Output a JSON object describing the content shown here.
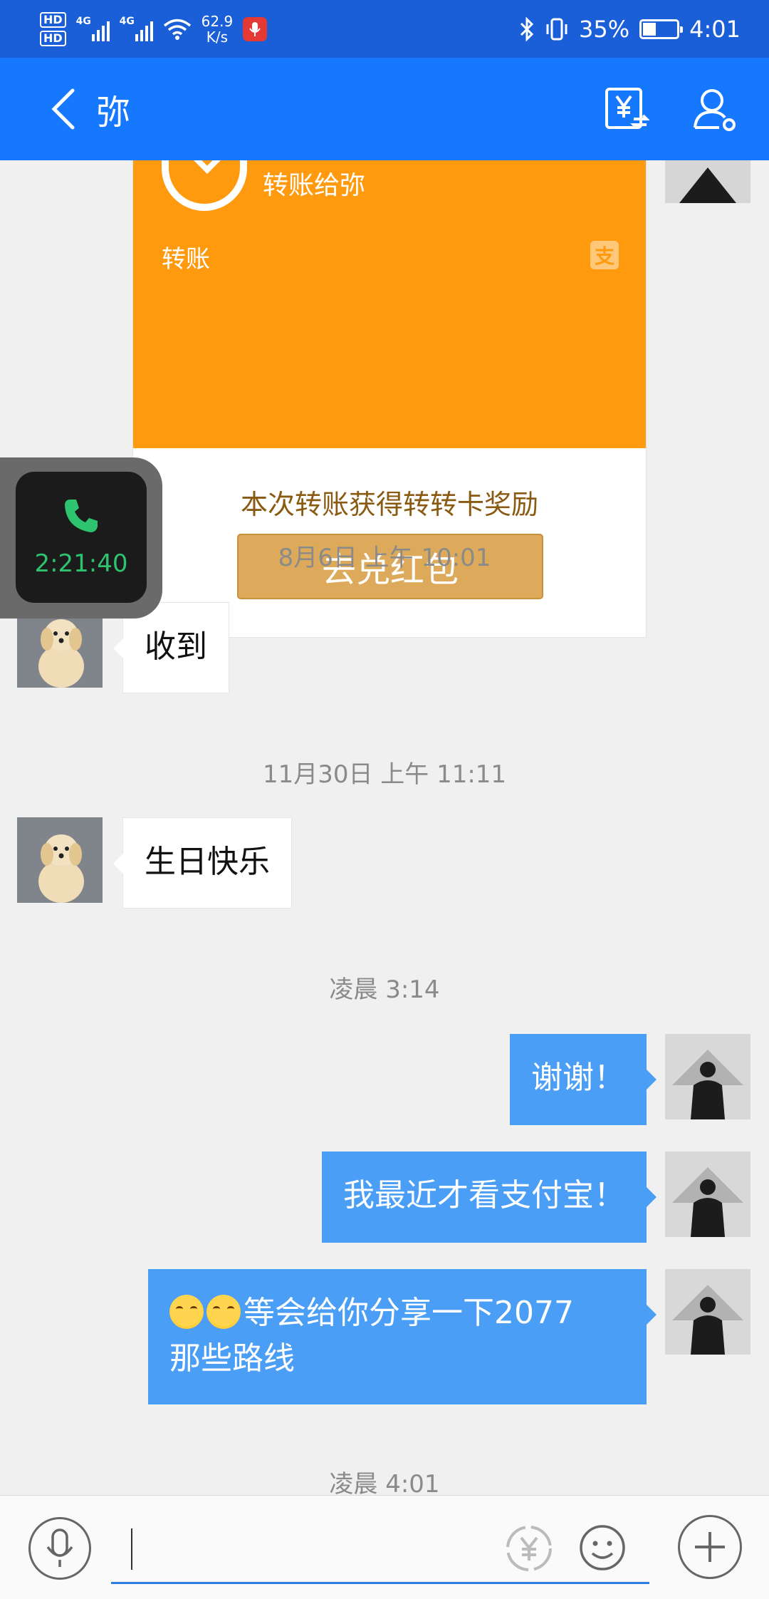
{
  "status_bar": {
    "hd1": "HD",
    "hd2": "HD",
    "net1": "4G",
    "net2": "4G",
    "speed_value": "62.9",
    "speed_unit": "K/s",
    "battery": "35%",
    "time": "4:01",
    "icons": [
      "signal-icon",
      "wifi-icon",
      "mic-record-icon",
      "bluetooth-icon",
      "vibrate-icon",
      "battery-icon"
    ]
  },
  "header": {
    "title": "弥",
    "icons": [
      "back-icon",
      "transfer-icon",
      "contact-settings-icon"
    ]
  },
  "transfer_card": {
    "description": "转账给弥",
    "label": "转账",
    "reward_text": "本次转账获得转转卡奖励",
    "redeem_button": "去兑红包"
  },
  "call_widget": {
    "duration": "2:21:40"
  },
  "messages": [
    {
      "type": "timestamp",
      "text": "8月6日 上午 10:01"
    },
    {
      "type": "incoming",
      "text": "收到"
    },
    {
      "type": "timestamp",
      "text": "11月30日 上午 11:11"
    },
    {
      "type": "incoming",
      "text": "生日快乐"
    },
    {
      "type": "timestamp",
      "text": "凌晨 3:14"
    },
    {
      "type": "outgoing",
      "text": "谢谢！"
    },
    {
      "type": "outgoing",
      "text": "我最近才看支付宝！"
    },
    {
      "type": "outgoing",
      "text": "等会给你分享一下2077",
      "line2": "那些路线"
    },
    {
      "type": "timestamp",
      "text": "凌晨 4:01"
    }
  ],
  "input_bar": {
    "placeholder": "",
    "icons": [
      "microphone-icon",
      "yuan-icon",
      "emoji-icon",
      "plus-icon"
    ]
  },
  "colors": {
    "status_bar": "#1a5fd8",
    "header": "#1677ff",
    "outgoing_bubble": "#4a9ef6",
    "transfer_orange": "#ff9a0e",
    "redeem_button": "#ddaa5b",
    "call_green": "#2ec46f"
  }
}
